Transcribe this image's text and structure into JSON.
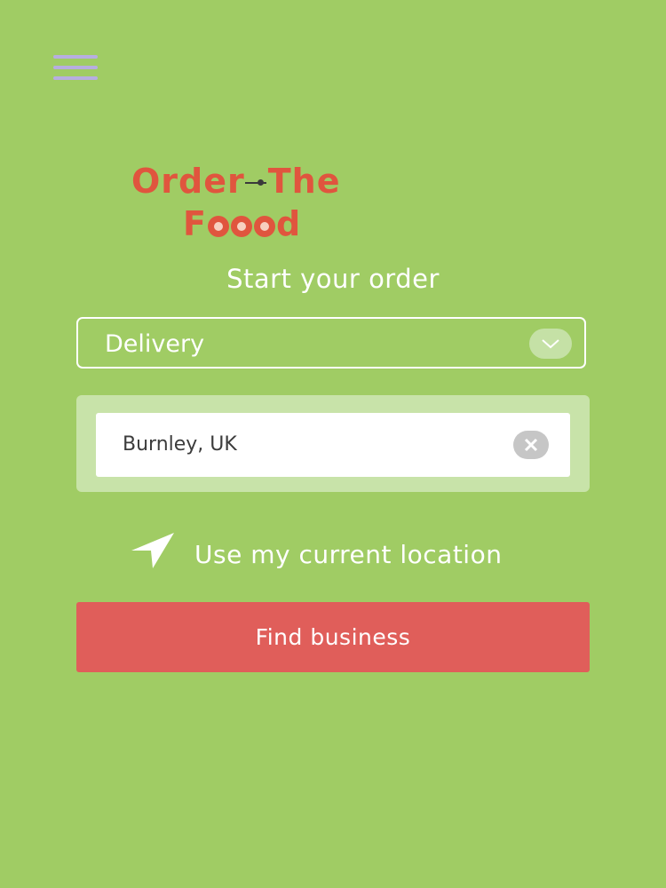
{
  "header": {
    "menu_icon": "hamburger-menu-icon"
  },
  "logo": {
    "line1_part1": "Order",
    "line1_part2": "The",
    "line2_start": "F",
    "line2_end": "d"
  },
  "subtitle": "Start your order",
  "order_type": {
    "selected": "Delivery",
    "icon": "chevron-down-icon"
  },
  "location_search": {
    "value": "Burnley, UK",
    "clear_icon": "clear-icon"
  },
  "current_location": {
    "label": "Use my current location",
    "icon": "navigation-arrow-icon"
  },
  "find_button": {
    "label": "Find business"
  },
  "colors": {
    "background": "#a0cc64",
    "brand": "#e0553e",
    "button": "#e05e5a",
    "menu_icon": "#b7aee0"
  }
}
